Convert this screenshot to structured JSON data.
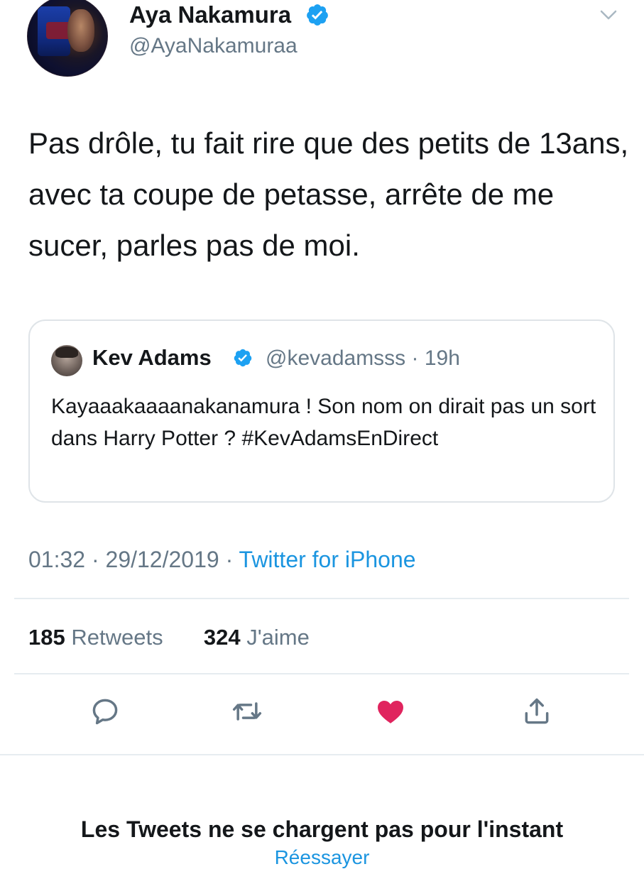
{
  "tweet": {
    "author": {
      "name": "Aya Nakamura",
      "handle": "@AyaNakamuraa",
      "verified": true
    },
    "text": "Pas drôle, tu fait rire que des petits de 13ans, avec ta coupe de petasse, arrête de me sucer, parles pas de moi.",
    "timestamp": "01:32 · 29/12/2019 · ",
    "source": "Twitter for iPhone",
    "stats": {
      "retweets_count": "185",
      "retweets_label": "Retweets",
      "likes_count": "324",
      "likes_label": "J'aime"
    }
  },
  "quoted_tweet": {
    "name": "Kev Adams",
    "handle_and_time": "@kevadamsss · 19h",
    "verified": true,
    "text": "Kayaaakaaaanakanamura ! Son nom on dirait pas un sort dans Harry Potter ? #KevAdamsEnDirect"
  },
  "actions": {
    "reply_icon": "reply-icon",
    "retweet_icon": "retweet-icon",
    "like_icon": "heart-icon",
    "share_icon": "share-icon"
  },
  "footer": {
    "status_message": "Les Tweets ne se chargent pas pour l'instant",
    "retry_label": "Réessayer"
  },
  "colors": {
    "text": "#14171a",
    "secondary_text": "#657786",
    "link": "#1b95e0",
    "verified": "#1da1f2",
    "like_active": "#e0245e",
    "divider": "#e6ecf0"
  }
}
